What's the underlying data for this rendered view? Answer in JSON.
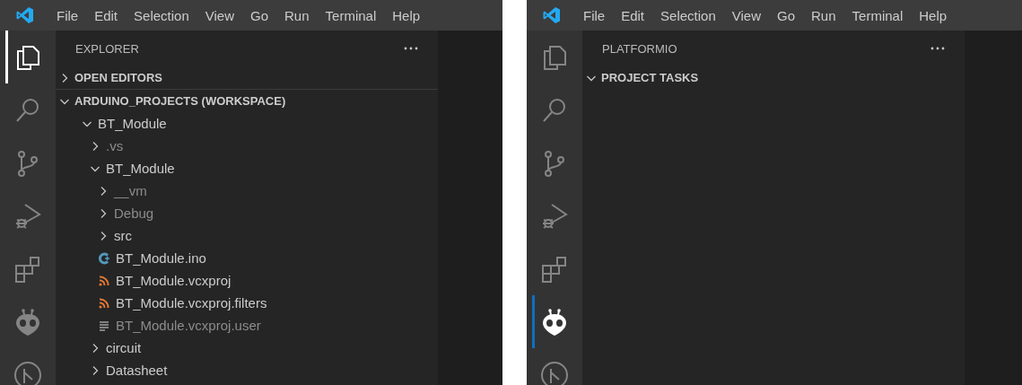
{
  "panels": [
    {
      "menu": [
        "File",
        "Edit",
        "Selection",
        "View",
        "Go",
        "Run",
        "Terminal",
        "Help"
      ],
      "activity_bar": [
        {
          "kind": "explorer",
          "selected": true
        },
        {
          "kind": "search",
          "selected": false
        },
        {
          "kind": "source-control",
          "selected": false
        },
        {
          "kind": "run-debug",
          "selected": false
        },
        {
          "kind": "extensions",
          "selected": false
        },
        {
          "kind": "alien",
          "selected": false
        },
        {
          "kind": "branch-circle",
          "selected": false
        }
      ],
      "sidebar": {
        "title": "EXPLORER",
        "sections": [
          {
            "title": "OPEN EDITORS",
            "expanded": false
          },
          {
            "title": "ARDUINO_PROJECTS (WORKSPACE)",
            "expanded": true,
            "children": [
              {
                "kind": "folder",
                "name": "BT_Module",
                "expanded": true,
                "dimmed": false,
                "children": [
                  {
                    "kind": "folder",
                    "name": ".vs",
                    "expanded": false,
                    "dimmed": true
                  },
                  {
                    "kind": "folder",
                    "name": "BT_Module",
                    "expanded": true,
                    "dimmed": false,
                    "children": [
                      {
                        "kind": "folder",
                        "name": "__vm",
                        "expanded": false,
                        "dimmed": true
                      },
                      {
                        "kind": "folder",
                        "name": "Debug",
                        "expanded": false,
                        "dimmed": true
                      },
                      {
                        "kind": "folder",
                        "name": "src",
                        "expanded": false,
                        "dimmed": false
                      },
                      {
                        "kind": "arduino-file",
                        "name": "BT_Module.ino",
                        "dimmed": false
                      },
                      {
                        "kind": "xml-file",
                        "name": "BT_Module.vcxproj",
                        "dimmed": false
                      },
                      {
                        "kind": "xml-file",
                        "name": "BT_Module.vcxproj.filters",
                        "dimmed": false
                      },
                      {
                        "kind": "text-file",
                        "name": "BT_Module.vcxproj.user",
                        "dimmed": true
                      }
                    ]
                  },
                  {
                    "kind": "folder",
                    "name": "circuit",
                    "expanded": false,
                    "dimmed": false
                  },
                  {
                    "kind": "folder",
                    "name": "Datasheet",
                    "expanded": false,
                    "dimmed": false
                  }
                ]
              }
            ]
          }
        ]
      }
    },
    {
      "menu": [
        "File",
        "Edit",
        "Selection",
        "View",
        "Go",
        "Run",
        "Terminal",
        "Help"
      ],
      "activity_bar": [
        {
          "kind": "explorer",
          "selected": false
        },
        {
          "kind": "search",
          "selected": false
        },
        {
          "kind": "source-control",
          "selected": false
        },
        {
          "kind": "run-debug",
          "selected": false
        },
        {
          "kind": "extensions",
          "selected": false
        },
        {
          "kind": "alien",
          "selected": true
        },
        {
          "kind": "branch-circle",
          "selected": false
        }
      ],
      "sidebar": {
        "title": "PLATFORMIO",
        "sections": [
          {
            "title": "PROJECT TASKS",
            "expanded": true
          }
        ]
      }
    }
  ]
}
